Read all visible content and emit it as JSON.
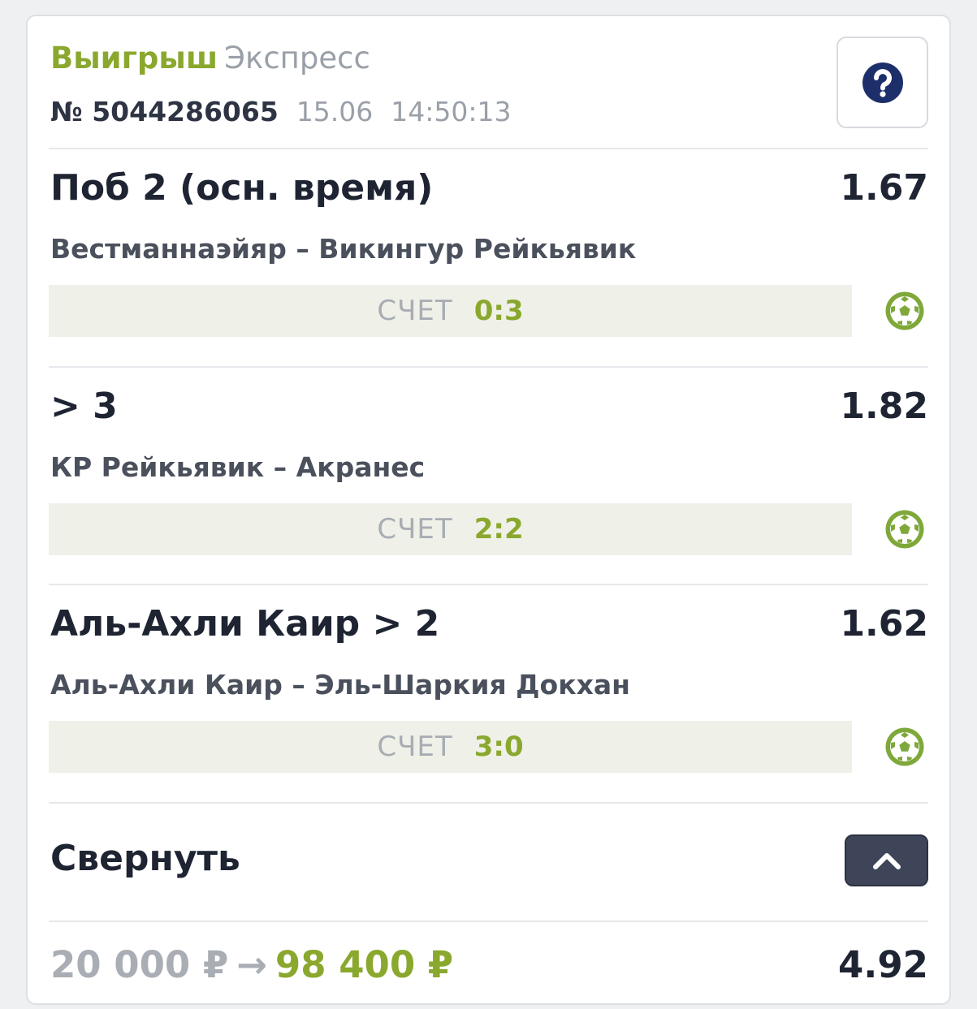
{
  "header": {
    "status": "Выигрыш",
    "type": "Экспресс",
    "ticket_number": "№ 5044286065",
    "date": "15.06",
    "time": "14:50:13",
    "help_icon": "question-circle-icon"
  },
  "selections": [
    {
      "title": "Поб 2 (осн. время)",
      "odds": "1.67",
      "match": "Вестманнаэйяр – Викингур Рейкьявик",
      "score_label": "СЧЕТ",
      "score": "0:3",
      "sport_icon": "soccer-ball-icon"
    },
    {
      "title": "> 3",
      "odds": "1.82",
      "match": "КР Рейкьявик – Акранес",
      "score_label": "СЧЕТ",
      "score": "2:2",
      "sport_icon": "soccer-ball-icon"
    },
    {
      "title": "Аль-Ахли Каир > 2",
      "odds": "1.62",
      "match": "Аль-Ахли Каир – Эль-Шаркия Докхан",
      "score_label": "СЧЕТ",
      "score": "3:0",
      "sport_icon": "soccer-ball-icon"
    }
  ],
  "collapse": {
    "label": "Свернуть",
    "icon": "chevron-up-icon"
  },
  "totals": {
    "stake": "20 000 ₽",
    "arrow": "→",
    "payout": "98 400 ₽",
    "total_odds": "4.92"
  },
  "colors": {
    "win_green": "#8aa82e",
    "text_dark": "#1f2433",
    "muted_gray": "#9aa0a8",
    "score_bg": "#eff0e8",
    "help_icon_blue": "#1c2f6b",
    "collapse_button_bg": "#3e4558"
  }
}
